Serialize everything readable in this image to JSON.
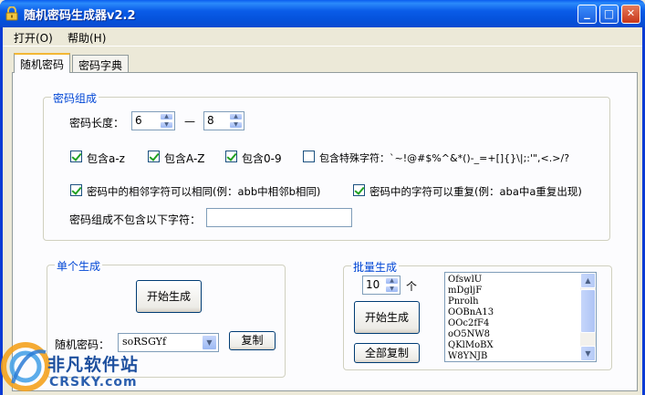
{
  "window": {
    "title": "随机密码生成器v2.2",
    "minimize_glyph": "_",
    "maximize_glyph": "□",
    "close_glyph": "✕"
  },
  "menu": {
    "items": [
      {
        "label": "打开(O)"
      },
      {
        "label": "帮助(H)"
      }
    ]
  },
  "tabs": [
    {
      "label": "随机密码",
      "active": true
    },
    {
      "label": "密码字典",
      "active": false
    }
  ],
  "composition": {
    "group_title": "密码组成",
    "length_label": "密码长度：",
    "length_min": "6",
    "length_sep": "—",
    "length_max": "8",
    "options": [
      {
        "label": "包含a-z",
        "checked": true
      },
      {
        "label": "包含A-Z",
        "checked": true
      },
      {
        "label": "包含0-9",
        "checked": true
      },
      {
        "label": "包含特殊字符：`~!@#$%^&*()-_=+[]{}\\|;:'\",<.>/?",
        "checked": false
      }
    ],
    "adjacent_label": "密码中的相邻字符可以相同(例：abb中相邻b相同)",
    "adjacent_checked": true,
    "repeat_label": "密码中的字符可以重复(例：aba中a重复出现)",
    "repeat_checked": true,
    "exclude_label": "密码组成不包含以下字符：",
    "exclude_value": ""
  },
  "single": {
    "group_title": "单个生成",
    "generate_label": "开始生成",
    "password_label": "随机密码：",
    "password_value": "soRSGYf",
    "copy_label": "复制"
  },
  "batch": {
    "group_title": "批量生成",
    "count_value": "10",
    "count_unit": "个",
    "generate_label": "开始生成",
    "copy_all_label": "全部复制",
    "results": [
      "OfswlU",
      "mDgljF",
      "Pnrolh",
      "OOBnA13",
      "OOc2fF4",
      "oO5NW8",
      "QKlMoBX",
      "W8YNJB"
    ]
  },
  "watermark": {
    "name": "非凡软件站",
    "domain": "CRSKY.com"
  },
  "colors": {
    "titlebar": "#0a5ce8",
    "group_title": "#0046d5",
    "check": "#21a121",
    "tab_highlight": "#f3b735"
  }
}
